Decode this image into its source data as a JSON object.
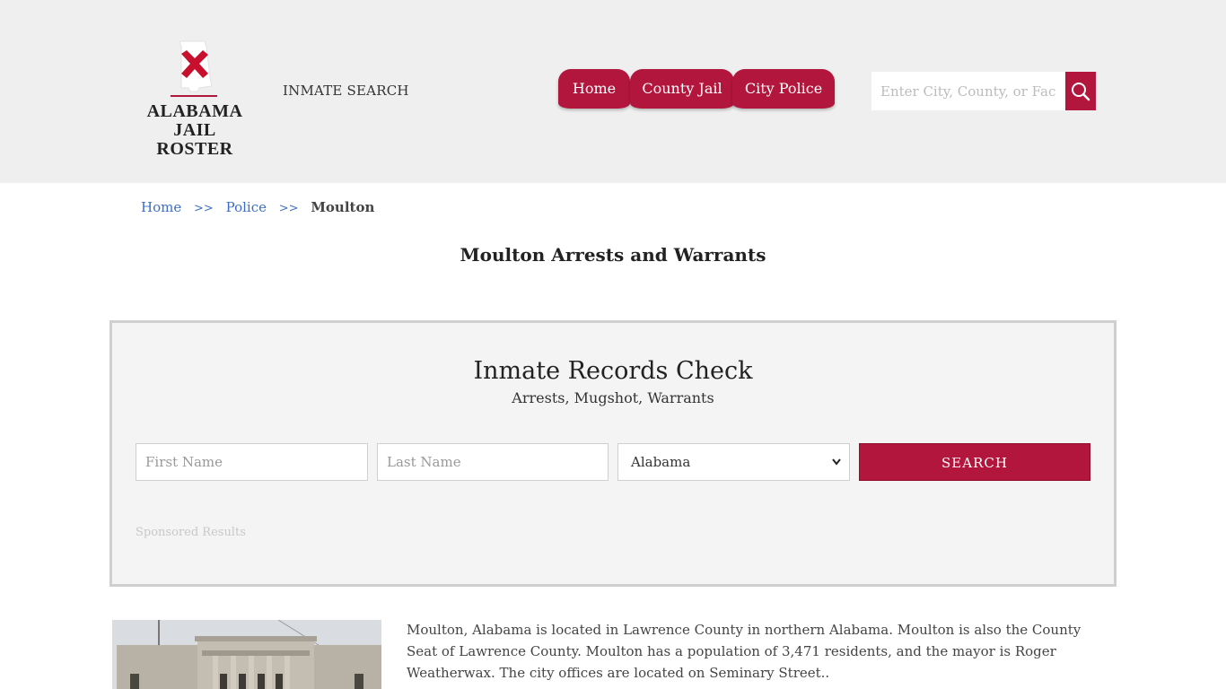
{
  "header": {
    "logo_line1": "ALABAMA",
    "logo_line2": "JAIL ROSTER",
    "inmate_search_label": "INMATE SEARCH",
    "nav": {
      "home": "Home",
      "county_jail": "County Jail",
      "city_police": "City Police"
    },
    "search_placeholder": "Enter City, County, or Facil"
  },
  "breadcrumb": {
    "home": "Home",
    "sep": ">>",
    "police": "Police",
    "current": "Moulton"
  },
  "page_title": "Moulton Arrests and Warrants",
  "records": {
    "title": "Inmate Records Check",
    "subtitle": "Arrests, Mugshot, Warrants",
    "first_name_placeholder": "First Name",
    "last_name_placeholder": "Last Name",
    "state_selected": "Alabama",
    "search_label": "SEARCH",
    "sponsored": "Sponsored Results"
  },
  "intro": "Moulton, Alabama is located in Lawrence County in northern Alabama. Moulton is also the County Seat of Lawrence County. Moulton has a population of 3,471 residents, and the mayor is Roger Weatherwax. The city offices are located on Seminary Street..",
  "colors": {
    "accent": "#b3163c",
    "header_bg": "#efefef",
    "link": "#3b6fc7",
    "panel_bg": "#f4f4f4"
  },
  "icons": {
    "logo": "alabama-state-flag-icon",
    "search": "magnifier-icon",
    "select": "chevron-down-icon"
  }
}
